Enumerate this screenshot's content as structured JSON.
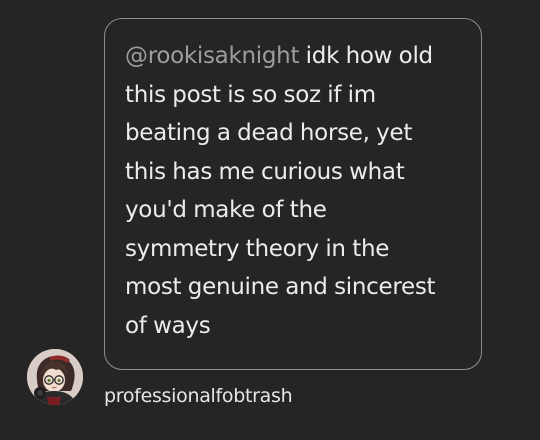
{
  "ask": {
    "mention": "@rookisaknight",
    "lines": [
      " idk how old",
      "this post is so soz if im",
      "beating a dead horse, yet",
      "this has me curious what",
      "you'd make of the",
      "symmetry theory in the",
      "most genuine and sincerest",
      "of ways"
    ]
  },
  "asker": {
    "username": "professionalfobtrash",
    "avatar_icon": "avatar-illustration-icon"
  },
  "colors": {
    "background": "#252525",
    "text": "#ececec",
    "mention": "#9d9d9d",
    "bubble_border": "#8e8e8e"
  }
}
